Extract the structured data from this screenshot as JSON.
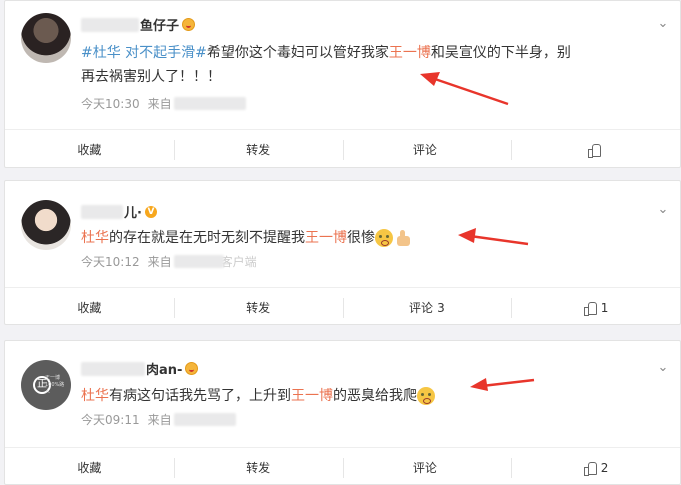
{
  "posts": [
    {
      "user_visible": "鱼仔子",
      "badge": "crown",
      "text": {
        "tag1": "#杜华 对不起手滑#",
        "pre": "希望你这个毒妇可以管好我家",
        "name": "王一博",
        "post": "和吴宣仪的下半身，别再去祸害别人了！！！"
      },
      "time": "今天10:30",
      "source_prefix": "来自",
      "source_visible": "",
      "actions": {
        "fav": "收藏",
        "repost": "转发",
        "comment": "评论",
        "comment_count": "",
        "like_count": ""
      }
    },
    {
      "user_visible": "儿·",
      "badge": "v",
      "text": {
        "tag1": "杜华",
        "pre": "的存在就是在无时无刻不提醒我",
        "name": "王一博",
        "post": "很惨"
      },
      "time": "今天10:12",
      "source_prefix": "来自",
      "source_visible": "客户端",
      "actions": {
        "fav": "收藏",
        "repost": "转发",
        "comment": "评论",
        "comment_count": "3",
        "like_count": "1"
      }
    },
    {
      "user_visible": "肉an-",
      "badge": "crown",
      "avatar_text": "正",
      "avatar_small": "王一博\n100%路人",
      "text": {
        "tag1": "杜华",
        "pre": "有病这句话我先骂了，上升到",
        "name": "王一博",
        "post": "的恶臭给我爬"
      },
      "time": "今天09:11",
      "source_prefix": "来自",
      "source_visible": "",
      "actions": {
        "fav": "收藏",
        "repost": "转发",
        "comment": "评论",
        "comment_count": "",
        "like_count": "2"
      }
    }
  ],
  "icons": {
    "chevron": "chevron-down-icon",
    "like": "thumbs-up-icon"
  },
  "colors": {
    "highlight": "#eb7350",
    "topic": "#4a90c8",
    "arrow": "#e8352b"
  }
}
